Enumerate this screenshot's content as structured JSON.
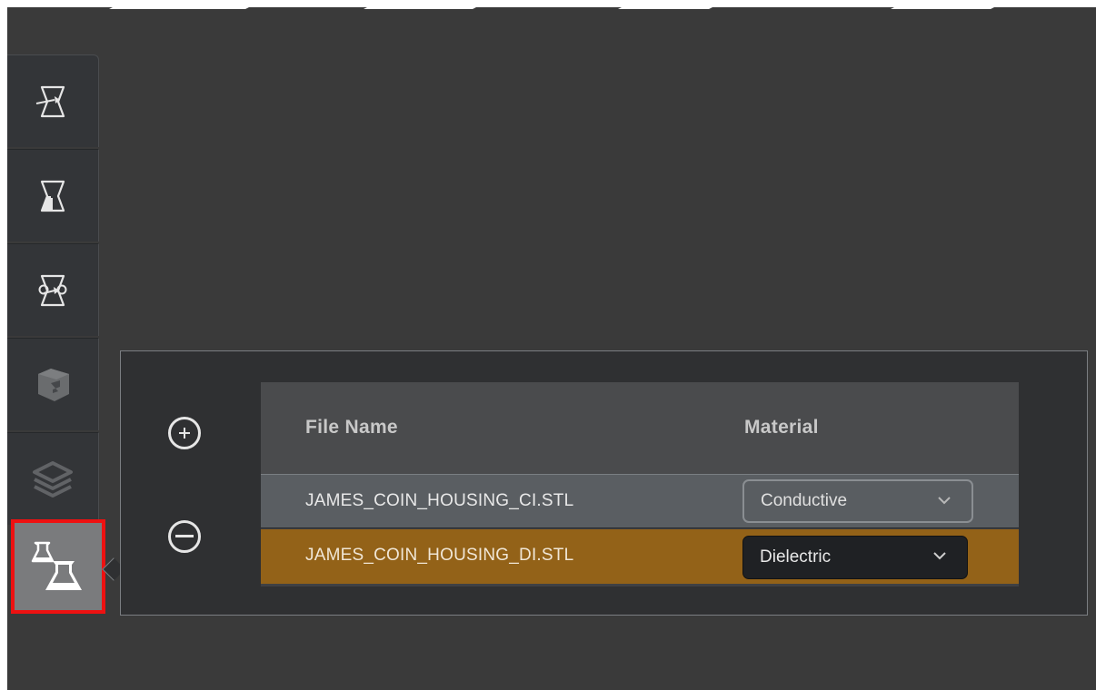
{
  "toolbar": {
    "tools": [
      {
        "icon": "flask-outline-arrow-icon"
      },
      {
        "icon": "flask-half-filled-icon"
      },
      {
        "icon": "flask-cycle-arrow-icon"
      },
      {
        "icon": "box-3d-icon"
      },
      {
        "icon": "layers-stack-icon"
      },
      {
        "icon": "two-flasks-icon",
        "active": true
      }
    ]
  },
  "panel": {
    "add_icon": "plus-circle-icon",
    "remove_icon": "minus-circle-icon",
    "table": {
      "columns": [
        "File Name",
        "Material"
      ],
      "rows": [
        {
          "file_name": "JAMES_COIN_HOUSING_CI.STL",
          "material": "Conductive",
          "selected": false
        },
        {
          "file_name": "JAMES_COIN_HOUSING_DI.STL",
          "material": "Dielectric",
          "selected": true
        }
      ]
    }
  },
  "colors": {
    "background": "#3a3a3a",
    "selected_row": "#936218",
    "highlight_outline": "#ee1111"
  }
}
